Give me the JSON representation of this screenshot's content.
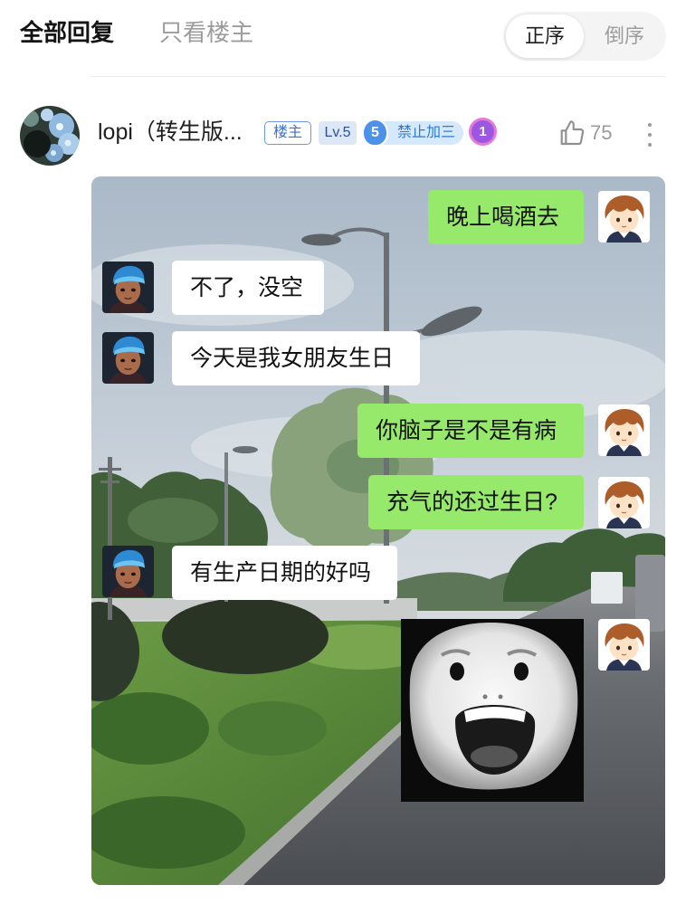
{
  "header": {
    "tabs": [
      {
        "label": "全部回复",
        "active": true
      },
      {
        "label": "只看楼主",
        "active": false
      }
    ],
    "sort_options": [
      {
        "label": "正序",
        "selected": true
      },
      {
        "label": "倒序",
        "selected": false
      }
    ]
  },
  "post": {
    "author": {
      "name": "lopi（转生版...",
      "avatar_icon": "user-avatar-icon",
      "badges": {
        "owner": "楼主",
        "level": "Lv.5",
        "group_level": "5",
        "group_title": "禁止加三",
        "medal": "1"
      }
    },
    "like": {
      "icon": "thumbs-up-icon",
      "count": "75"
    },
    "more_icon": "more-vertical-icon",
    "image": {
      "chat": [
        {
          "outgoing": true,
          "text": "晚上喝酒去"
        },
        {
          "outgoing": false,
          "text": "不了，没空"
        },
        {
          "outgoing": false,
          "text": "今天是我女朋友生日"
        },
        {
          "outgoing": true,
          "text": "你脑子是不是有病"
        },
        {
          "outgoing": true,
          "text": "充气的还过生日?"
        },
        {
          "outgoing": false,
          "text": "有生产日期的好吗"
        },
        {
          "outgoing": true,
          "sticker_icon": "shocked-face-sticker-icon"
        }
      ]
    }
  },
  "colors": {
    "text_primary": "#141414",
    "text_muted": "#9c9c9c",
    "outgoing_bubble": "#96e96b",
    "incoming_bubble": "#ffffff",
    "badge_blue": "#3a70d3",
    "medal_purple": "#9c57e2"
  }
}
